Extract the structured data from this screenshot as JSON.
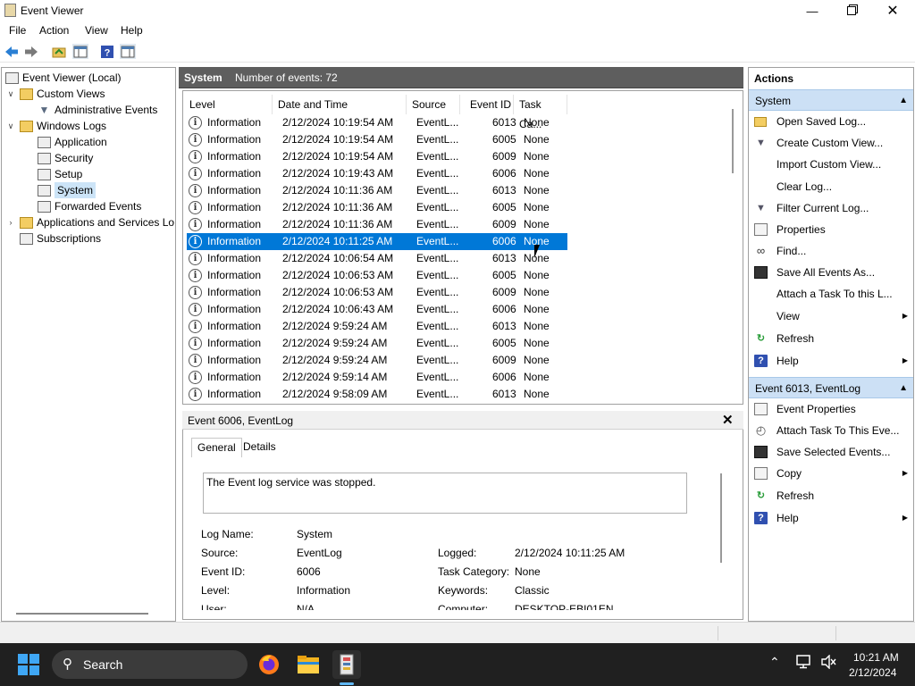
{
  "window": {
    "title": "Event Viewer",
    "minimize_icon": "minimize-icon",
    "maximize_icon": "restore-icon",
    "close_icon": "close-icon"
  },
  "menu": [
    "File",
    "Action",
    "View",
    "Help"
  ],
  "toolbar": [
    "back-arrow-icon",
    "forward-arrow-icon",
    "up-folder-icon",
    "show-hide-console-tree-icon",
    "help-icon",
    "show-hide-action-pane-icon"
  ],
  "tree": {
    "root": "Event Viewer (Local)",
    "custom_views": "Custom Views",
    "administrative_events": "Administrative Events",
    "windows_logs": "Windows Logs",
    "application": "Application",
    "security": "Security",
    "setup": "Setup",
    "system": "System",
    "forwarded_events": "Forwarded Events",
    "apps_services": "Applications and Services Lo",
    "subscriptions": "Subscriptions"
  },
  "center": {
    "title": "System",
    "count": "Number of events: 72"
  },
  "grid": {
    "columns": [
      "Level",
      "Date and Time",
      "Source",
      "Event ID",
      "Task Ca..."
    ],
    "rows": [
      [
        "Information",
        "2/12/2024 10:19:54 AM",
        "EventL...",
        "6013",
        "None"
      ],
      [
        "Information",
        "2/12/2024 10:19:54 AM",
        "EventL...",
        "6005",
        "None"
      ],
      [
        "Information",
        "2/12/2024 10:19:54 AM",
        "EventL...",
        "6009",
        "None"
      ],
      [
        "Information",
        "2/12/2024 10:19:43 AM",
        "EventL...",
        "6006",
        "None"
      ],
      [
        "Information",
        "2/12/2024 10:11:36 AM",
        "EventL...",
        "6013",
        "None"
      ],
      [
        "Information",
        "2/12/2024 10:11:36 AM",
        "EventL...",
        "6005",
        "None"
      ],
      [
        "Information",
        "2/12/2024 10:11:36 AM",
        "EventL...",
        "6009",
        "None"
      ],
      [
        "Information",
        "2/12/2024 10:11:25 AM",
        "EventL...",
        "6006",
        "None"
      ],
      [
        "Information",
        "2/12/2024 10:06:54 AM",
        "EventL...",
        "6013",
        "None"
      ],
      [
        "Information",
        "2/12/2024 10:06:53 AM",
        "EventL...",
        "6005",
        "None"
      ],
      [
        "Information",
        "2/12/2024 10:06:53 AM",
        "EventL...",
        "6009",
        "None"
      ],
      [
        "Information",
        "2/12/2024 10:06:43 AM",
        "EventL...",
        "6006",
        "None"
      ],
      [
        "Information",
        "2/12/2024 9:59:24 AM",
        "EventL...",
        "6013",
        "None"
      ],
      [
        "Information",
        "2/12/2024 9:59:24 AM",
        "EventL...",
        "6005",
        "None"
      ],
      [
        "Information",
        "2/12/2024 9:59:24 AM",
        "EventL...",
        "6009",
        "None"
      ],
      [
        "Information",
        "2/12/2024 9:59:14 AM",
        "EventL...",
        "6006",
        "None"
      ],
      [
        "Information",
        "2/12/2024 9:58:09 AM",
        "EventL...",
        "6013",
        "None"
      ]
    ],
    "selected_row": 7
  },
  "detail": {
    "title": "Event 6006, EventLog",
    "tabs": [
      "General",
      "Details"
    ],
    "description": "The Event log service was stopped.",
    "log_name_label": "Log Name:",
    "log_name": "System",
    "source_label": "Source:",
    "source": "EventLog",
    "logged_label": "Logged:",
    "logged": "2/12/2024 10:11:25 AM",
    "event_id_label": "Event ID:",
    "event_id": "6006",
    "task_category_label": "Task Category:",
    "task_category": "None",
    "level_label": "Level:",
    "level": "Information",
    "keywords_label": "Keywords:",
    "keywords": "Classic",
    "user_label": "User:",
    "user": "N/A",
    "computer_label": "Computer:",
    "computer": "DESKTOP-EBI01EN"
  },
  "actions": {
    "title": "Actions",
    "section1": "System",
    "section1_items": [
      {
        "label": "Open Saved Log...",
        "icon": "open-folder-icon",
        "submenu": false
      },
      {
        "label": "Create Custom View...",
        "icon": "filter-icon",
        "submenu": false
      },
      {
        "label": "Import Custom View...",
        "icon": "",
        "submenu": false
      },
      {
        "label": "Clear Log...",
        "icon": "",
        "submenu": false
      },
      {
        "label": "Filter Current Log...",
        "icon": "filter-icon",
        "submenu": false
      },
      {
        "label": "Properties",
        "icon": "properties-icon",
        "submenu": false
      },
      {
        "label": "Find...",
        "icon": "binoculars-icon",
        "submenu": false
      },
      {
        "label": "Save All Events As...",
        "icon": "save-icon",
        "submenu": false
      },
      {
        "label": "Attach a Task To this L...",
        "icon": "",
        "submenu": false
      },
      {
        "label": "View",
        "icon": "",
        "submenu": true
      },
      {
        "label": "Refresh",
        "icon": "refresh-icon",
        "submenu": false
      },
      {
        "label": "Help",
        "icon": "help-icon",
        "submenu": true
      }
    ],
    "section2": "Event 6013, EventLog",
    "section2_items": [
      {
        "label": "Event Properties",
        "icon": "properties-icon",
        "submenu": false
      },
      {
        "label": "Attach Task To This Eve...",
        "icon": "clock-icon",
        "submenu": false
      },
      {
        "label": "Save Selected Events...",
        "icon": "save-icon",
        "submenu": false
      },
      {
        "label": "Copy",
        "icon": "copy-icon",
        "submenu": true
      },
      {
        "label": "Refresh",
        "icon": "refresh-icon",
        "submenu": false
      },
      {
        "label": "Help",
        "icon": "help-icon",
        "submenu": true
      }
    ]
  },
  "taskbar": {
    "search_placeholder": "Search",
    "apps": [
      "firefox-icon",
      "file-explorer-icon",
      "event-viewer-icon"
    ],
    "time": "10:21 AM",
    "date": "2/12/2024"
  },
  "colors": {
    "selection": "#0078d7",
    "center_header": "#5e5e5e",
    "actions_section": "#cce0f5",
    "taskbar": "#202020"
  }
}
